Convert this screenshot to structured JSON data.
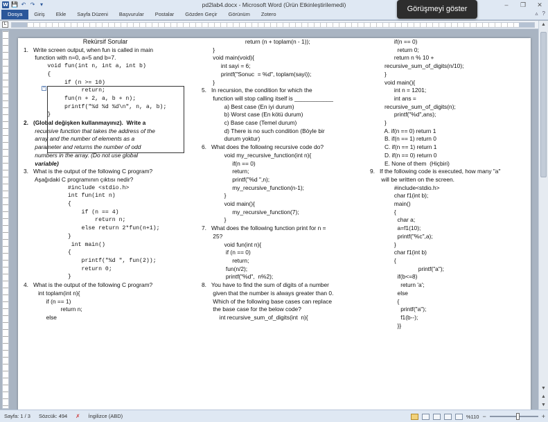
{
  "window": {
    "title": "pd2lab4.docx - Microsoft Word (Ürün Etkinleştirilemedi)",
    "controls": {
      "minimize": "–",
      "restore": "❐",
      "close": "✕"
    }
  },
  "quick_access": {
    "app_icon": "W",
    "save": "💾",
    "undo": "↶",
    "redo": "↷",
    "customize": "▾"
  },
  "meeting": {
    "label": "Görüşmeyi göster"
  },
  "ribbon": {
    "tabs": [
      "Dosya",
      "Giriş",
      "Ekle",
      "Sayfa Düzeni",
      "Başvurular",
      "Postalar",
      "Gözden Geçir",
      "Görünüm",
      "Zotero"
    ],
    "help": "?",
    "collapse": "▵"
  },
  "document": {
    "col1": [
      {
        "t": "Rekürsif Sorular",
        "cls": "heading"
      },
      {
        "t": "",
        "cls": ""
      },
      {
        "t": "1.   Write screen output, when fun is called in main",
        "cls": ""
      },
      {
        "t": "       function with n=0, a=5 and b=7.",
        "cls": ""
      },
      {
        "t": "       void fun(int n, int a, int b)",
        "cls": "mono"
      },
      {
        "t": "       {",
        "cls": "mono"
      },
      {
        "t": "            if (n >= 10)",
        "cls": "mono"
      },
      {
        "t": "                 return;",
        "cls": "mono"
      },
      {
        "t": "            fun(n + 2, a, b + n);",
        "cls": "mono"
      },
      {
        "t": "            printf(\"%d %d %d\\n\", n, a, b);",
        "cls": "mono"
      },
      {
        "t": "",
        "cls": ""
      },
      {
        "t": "       }",
        "cls": "mono"
      },
      {
        "t": "",
        "cls": ""
      },
      {
        "t": "2.   (Global değişken kullanmayınız).  Write a",
        "cls": "b"
      },
      {
        "t": "       recursive function that takes the address of the",
        "cls": "i"
      },
      {
        "t": "       array and the number of elements as a",
        "cls": "i"
      },
      {
        "t": "       parameter and returns the number of odd",
        "cls": "i"
      },
      {
        "t": "       numbers in the array. (Do not use global",
        "cls": "i"
      },
      {
        "t": "       variable)",
        "cls": "i b"
      },
      {
        "t": "3.   What is the output of the following C program?",
        "cls": ""
      },
      {
        "t": "       Aşağıdaki C programının çıktısı nedir?",
        "cls": ""
      },
      {
        "t": "",
        "cls": ""
      },
      {
        "t": "             #include <stdio.h>",
        "cls": "mono"
      },
      {
        "t": "",
        "cls": ""
      },
      {
        "t": "             int fun(int n)",
        "cls": "mono"
      },
      {
        "t": "             {",
        "cls": "mono"
      },
      {
        "t": "                 if (n == 4)",
        "cls": "mono"
      },
      {
        "t": "                     return n;",
        "cls": "mono"
      },
      {
        "t": "                 else return 2*fun(n+1);",
        "cls": "mono"
      },
      {
        "t": "             }",
        "cls": "mono"
      },
      {
        "t": "              int main()",
        "cls": "mono"
      },
      {
        "t": "             {",
        "cls": "mono"
      },
      {
        "t": "                 printf(\"%d \", fun(2));",
        "cls": "mono"
      },
      {
        "t": "                 return 0;",
        "cls": "mono"
      },
      {
        "t": "             }",
        "cls": "mono"
      },
      {
        "t": "",
        "cls": ""
      },
      {
        "t": "4.   What is the output of the following C program?",
        "cls": ""
      },
      {
        "t": "",
        "cls": ""
      },
      {
        "t": "         int toplam(int n){",
        "cls": ""
      },
      {
        "t": "              if (n == 1)",
        "cls": ""
      },
      {
        "t": "                       return n;",
        "cls": ""
      },
      {
        "t": "              else",
        "cls": ""
      }
    ],
    "col2": [
      {
        "t": "                           return (n + toplam(n - 1));",
        "cls": ""
      },
      {
        "t": "       }",
        "cls": ""
      },
      {
        "t": "       void main(void){",
        "cls": ""
      },
      {
        "t": "            int sayi = 6;",
        "cls": ""
      },
      {
        "t": "            printf(\"Sonuc  = %d\", toplam(sayi));",
        "cls": ""
      },
      {
        "t": "       }",
        "cls": ""
      },
      {
        "t": "",
        "cls": ""
      },
      {
        "t": "5.   In recursion, the condition for which the",
        "cls": ""
      },
      {
        "t": "       function will stop calling itself is ____________",
        "cls": ""
      },
      {
        "t": "              a) Best case (En iyi durum)",
        "cls": ""
      },
      {
        "t": "              b) Worst case (En kötü durum)",
        "cls": ""
      },
      {
        "t": "              c) Base case (Temel durum)",
        "cls": ""
      },
      {
        "t": "              d) There is no such condition (Böyle bir",
        "cls": ""
      },
      {
        "t": "              durum yoktur)",
        "cls": ""
      },
      {
        "t": "6.   What does the following recursive code do?",
        "cls": ""
      },
      {
        "t": "              void my_recursive_function(int n){",
        "cls": ""
      },
      {
        "t": "                   if(n == 0)",
        "cls": ""
      },
      {
        "t": "                   return;",
        "cls": ""
      },
      {
        "t": "                   printf(\"%d \",n);",
        "cls": ""
      },
      {
        "t": "                   my_recursive_function(n-1);",
        "cls": ""
      },
      {
        "t": "              }",
        "cls": ""
      },
      {
        "t": "              void main(){",
        "cls": ""
      },
      {
        "t": "                   my_recursive_function(7);",
        "cls": ""
      },
      {
        "t": "              }",
        "cls": ""
      },
      {
        "t": "7.   What does the following function print for n =",
        "cls": ""
      },
      {
        "t": "       25?",
        "cls": ""
      },
      {
        "t": "              void fun(int n){",
        "cls": ""
      },
      {
        "t": "               if (n == 0)",
        "cls": ""
      },
      {
        "t": "                   return;",
        "cls": ""
      },
      {
        "t": "",
        "cls": ""
      },
      {
        "t": "               fun(n/2);",
        "cls": ""
      },
      {
        "t": "               printf(\"%d\",  n%2);",
        "cls": ""
      },
      {
        "t": "8.   You have to find the sum of digits of a number",
        "cls": ""
      },
      {
        "t": "       given that the number is always greater than 0.",
        "cls": ""
      },
      {
        "t": "       Which of the following base cases can replace",
        "cls": ""
      },
      {
        "t": "       the base case for the below code?",
        "cls": ""
      },
      {
        "t": "",
        "cls": ""
      },
      {
        "t": "           int recursive_sum_of_digits(int  n){",
        "cls": ""
      }
    ],
    "col3": [
      {
        "t": "               if(n == 0)",
        "cls": ""
      },
      {
        "t": "                 return 0;",
        "cls": ""
      },
      {
        "t": "               return n % 10 +",
        "cls": ""
      },
      {
        "t": "         recursive_sum_of_digits(n/10);",
        "cls": ""
      },
      {
        "t": "         }",
        "cls": ""
      },
      {
        "t": "         void main(){",
        "cls": ""
      },
      {
        "t": "               int n = 1201;",
        "cls": ""
      },
      {
        "t": "               int ans =",
        "cls": ""
      },
      {
        "t": "         recursive_sum_of_digits(n);",
        "cls": ""
      },
      {
        "t": "               printf(\"%d\",ans);",
        "cls": ""
      },
      {
        "t": "         }",
        "cls": ""
      },
      {
        "t": "         A. if(n == 0) return 1",
        "cls": ""
      },
      {
        "t": "         B. if(n == 1) return 0",
        "cls": ""
      },
      {
        "t": "         C. if(n == 1) return 1",
        "cls": ""
      },
      {
        "t": "         D. if(n == 0) return 0",
        "cls": ""
      },
      {
        "t": "         E. None of them  (Hiçbiri)",
        "cls": ""
      },
      {
        "t": "9.   If the following code is executed, how many \"a\"",
        "cls": ""
      },
      {
        "t": "       will be written on the screen.",
        "cls": ""
      },
      {
        "t": "               #include<stdio.h>",
        "cls": ""
      },
      {
        "t": "               char f1(int b);",
        "cls": ""
      },
      {
        "t": "               main()",
        "cls": ""
      },
      {
        "t": "               {",
        "cls": ""
      },
      {
        "t": "                 char a;",
        "cls": ""
      },
      {
        "t": "                 a=f1(10);",
        "cls": ""
      },
      {
        "t": "                 printf(\"%c\",a);",
        "cls": ""
      },
      {
        "t": "               }",
        "cls": ""
      },
      {
        "t": "               char f1(int b)",
        "cls": ""
      },
      {
        "t": "               {",
        "cls": ""
      },
      {
        "t": "                              printf(\"a\");",
        "cls": ""
      },
      {
        "t": "                 if(b<=8)",
        "cls": ""
      },
      {
        "t": "                   return 'a';",
        "cls": ""
      },
      {
        "t": "                 else",
        "cls": ""
      },
      {
        "t": "                 {",
        "cls": ""
      },
      {
        "t": "                   printf(\"a\");",
        "cls": ""
      },
      {
        "t": "                   f1(b--);",
        "cls": ""
      },
      {
        "t": "                 }}",
        "cls": ""
      }
    ]
  },
  "status": {
    "page": "Sayfa: 1 / 3",
    "words": "Sözcük: 494",
    "language": "İngilizce (ABD)",
    "zoom": "%110",
    "zoom_minus": "−",
    "zoom_plus": "+"
  },
  "scrollbar": {
    "up": "▲",
    "down": "▼",
    "prev": "▲",
    "next": "▼"
  },
  "ruler": {
    "tab_selector": "L"
  }
}
